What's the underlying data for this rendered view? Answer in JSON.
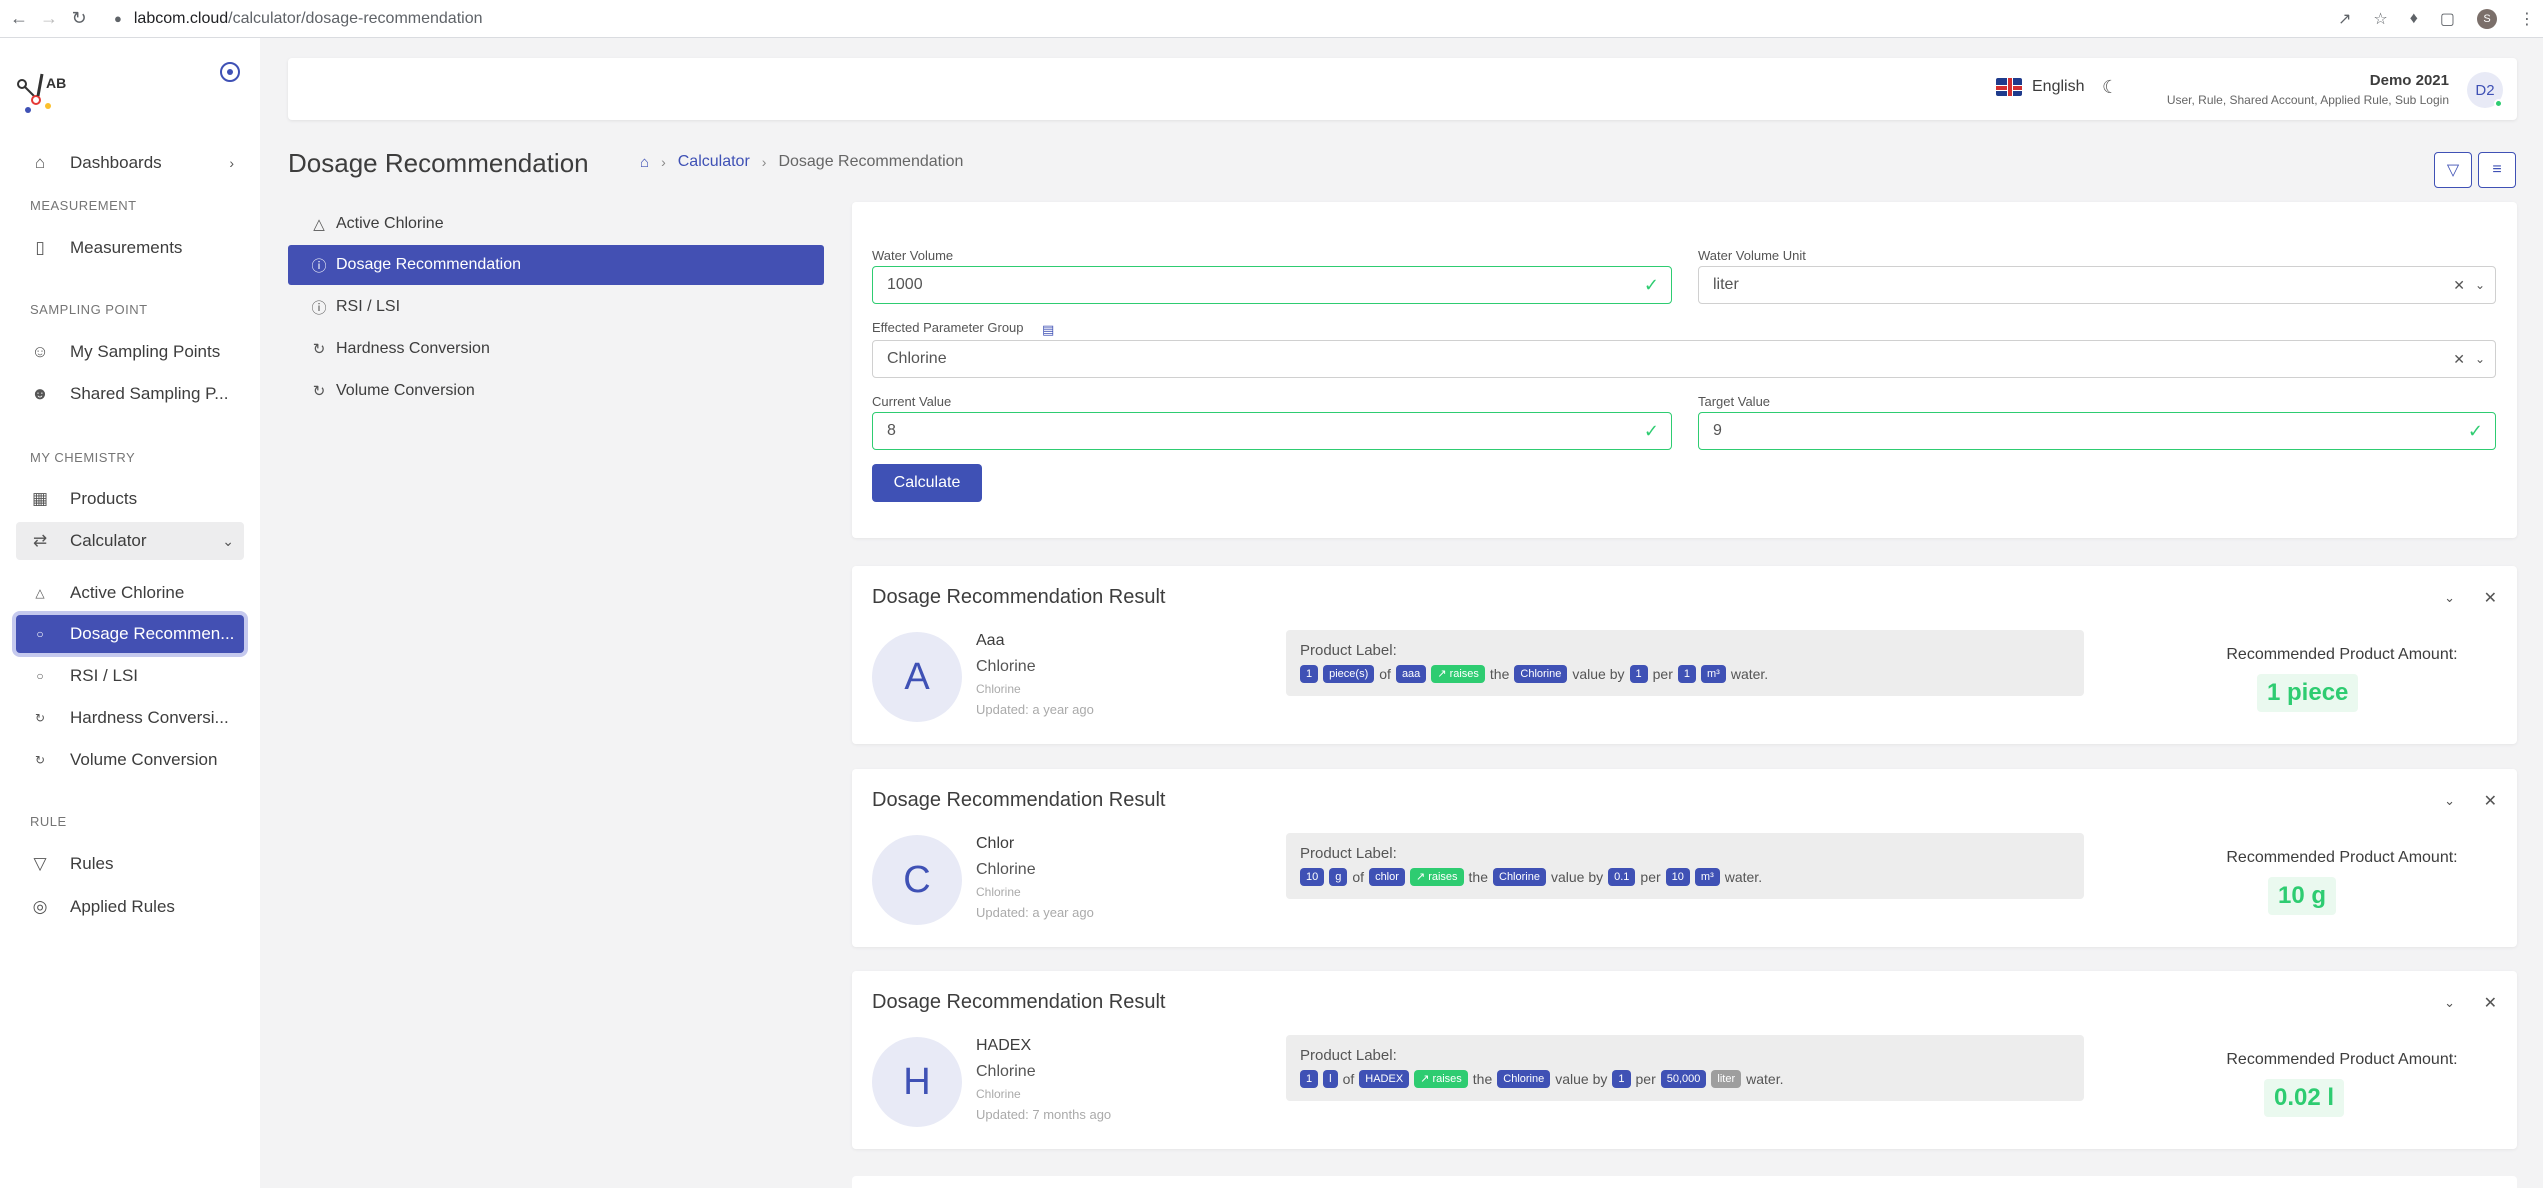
{
  "browser": {
    "url_host": "labcom.cloud",
    "url_path": "/calculator/dosage-recommendation",
    "profile_initial": "S"
  },
  "sidebar": {
    "items": [
      {
        "label": "Dashboards",
        "icon": "home-icon"
      },
      {
        "label": "Measurements",
        "icon": "thermometer-icon"
      },
      {
        "label": "My Sampling Points",
        "icon": "user-icon"
      },
      {
        "label": "Shared Sampling P...",
        "icon": "users-icon"
      },
      {
        "label": "Products",
        "icon": "calendar-icon"
      },
      {
        "label": "Calculator",
        "icon": "swap-icon"
      },
      {
        "label": "Active Chlorine",
        "icon": "warning-icon"
      },
      {
        "label": "Dosage Recommen...",
        "icon": "info-icon"
      },
      {
        "label": "RSI / LSI",
        "icon": "info-icon"
      },
      {
        "label": "Hardness Conversi...",
        "icon": "refresh-icon"
      },
      {
        "label": "Volume Conversion",
        "icon": "refresh-icon"
      },
      {
        "label": "Rules",
        "icon": "filter-icon"
      },
      {
        "label": "Applied Rules",
        "icon": "target-icon"
      }
    ],
    "sections": {
      "measurement": "MEASUREMENT",
      "sampling_point": "SAMPLING POINT",
      "my_chemistry": "MY CHEMISTRY",
      "rule": "RULE"
    }
  },
  "header": {
    "language": "English",
    "user_name": "Demo 2021",
    "user_roles": "User, Rule, Shared Account, Applied Rule, Sub Login",
    "avatar_initials": "D2"
  },
  "page": {
    "title": "Dosage Recommendation",
    "breadcrumb": [
      "Calculator",
      "Dosage Recommendation"
    ]
  },
  "calc_nav": [
    {
      "label": "Active Chlorine",
      "icon": "warning-icon"
    },
    {
      "label": "Dosage Recommendation",
      "icon": "info-icon"
    },
    {
      "label": "RSI / LSI",
      "icon": "info-icon"
    },
    {
      "label": "Hardness Conversion",
      "icon": "refresh-icon"
    },
    {
      "label": "Volume Conversion",
      "icon": "refresh-icon"
    }
  ],
  "form": {
    "water_volume_label": "Water Volume",
    "water_volume_value": "1000",
    "water_volume_unit_label": "Water Volume Unit",
    "water_volume_unit_value": "liter",
    "parameter_group_label": "Effected Parameter Group",
    "parameter_group_value": "Chlorine",
    "current_value_label": "Current Value",
    "current_value": "8",
    "target_value_label": "Target Value",
    "target_value": "9",
    "calculate_label": "Calculate"
  },
  "results": [
    {
      "title": "Dosage Recommendation Result",
      "initial": "A",
      "name": "Aaa",
      "group": "Chlorine",
      "param": "Chlorine",
      "updated": "Updated: a year ago",
      "label_title": "Product Label:",
      "label_parts": {
        "amount": "1",
        "unit": "piece(s)",
        "of": "of",
        "product": "aaa",
        "effect": "raises",
        "the": "the",
        "parameter": "Chlorine",
        "value_by": "value by",
        "by": "1",
        "per": "per",
        "per_amount": "1",
        "per_unit": "m³",
        "water": "water."
      },
      "amount_title": "Recommended Product Amount:",
      "amount": "1 piece"
    },
    {
      "title": "Dosage Recommendation Result",
      "initial": "C",
      "name": "Chlor",
      "group": "Chlorine",
      "param": "Chlorine",
      "updated": "Updated: a year ago",
      "label_title": "Product Label:",
      "label_parts": {
        "amount": "10",
        "unit": "g",
        "of": "of",
        "product": "chlor",
        "effect": "raises",
        "the": "the",
        "parameter": "Chlorine",
        "value_by": "value by",
        "by": "0.1",
        "per": "per",
        "per_amount": "10",
        "per_unit": "m³",
        "water": "water."
      },
      "amount_title": "Recommended Product Amount:",
      "amount": "10 g"
    },
    {
      "title": "Dosage Recommendation Result",
      "initial": "H",
      "name": "HADEX",
      "group": "Chlorine",
      "param": "Chlorine",
      "updated": "Updated: 7 months ago",
      "label_title": "Product Label:",
      "label_parts": {
        "amount": "1",
        "unit": "l",
        "of": "of",
        "product": "HADEX",
        "effect": "raises",
        "the": "the",
        "parameter": "Chlorine",
        "value_by": "value by",
        "by": "1",
        "per": "per",
        "per_amount": "50,000",
        "per_unit": "liter",
        "water": "water."
      },
      "amount_title": "Recommended Product Amount:",
      "amount": "0.02 l"
    }
  ],
  "colors": {
    "primary": "#3f51b5",
    "success": "#2ecc71",
    "background": "#f3f3f4"
  }
}
